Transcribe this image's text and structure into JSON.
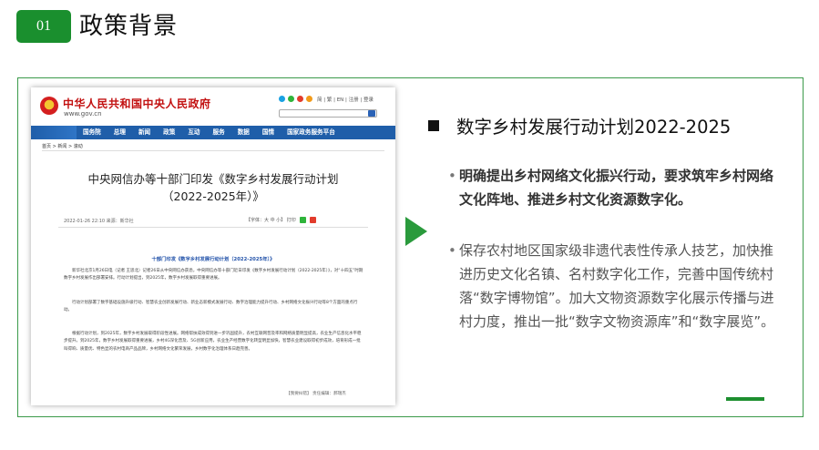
{
  "header": {
    "number": "01",
    "title": "政策背景"
  },
  "screenshot": {
    "site_name": "中华人民共和国中央人民政府",
    "site_url": "www.gov.cn",
    "top_links": "简 | 繁 | EN | 注册 | 登录",
    "nav": [
      "国务院",
      "总理",
      "新闻",
      "政策",
      "互动",
      "服务",
      "数据",
      "国情",
      "国家政务服务平台"
    ],
    "breadcrumb": "首页 > 新闻 > 滚动",
    "article_title_line1": "中央网信办等十部门印发《数字乡村发展行动计划",
    "article_title_line2": "（2022-2025年）》",
    "meta": "2022-01-26 22:10   来源：新华社",
    "meta_tools": "【字体：大 中 小】   打印",
    "sub_title": "十部门印发《数字乡村发展行动计划（2022-2025年）》",
    "para1": "新华社北京1月26日电（记者 王思北）记者26日从中央网信办获悉，中央网信办等十部门近日印发《数字乡村发展行动计划（2022-2025年）》，对“十四五”时期数字乡村发展作出部署安排。行动计划提出，到2025年，数字乡村发展取得重要进展。",
    "para2": "行动计划部署了数字基础设施升级行动、智慧农业创新发展行动、新业态新模式发展行动、数字治理能力提升行动、乡村网络文化振兴行动等8个方面的重点行动。",
    "para3": "根据行动计划，到2025年，数字乡村发展取得阶段性进展。网络帮扶成效得到进一步巩固提升，农村互联网普及率和网络质量明显提高，农业生产信息化水平稳步提升。到2025年，数字乡村发展取得重要进展，乡村4G深化普及、5G创新应用，农业生产经营数字化转型明显加快，智慧农业建设取得初步成效，培育形成一批叫得响、质量优、特色显的农村电商产品品牌，乡村网络文化繁荣发展，乡村数字化治理体系日趋完善。",
    "footer": "【我要纠错】    责任编辑：郝瑞杰"
  },
  "right": {
    "plan_title": "数字乡村发展行动计划2022-2025",
    "bullets": [
      "明确提出乡村网络文化振兴行动，要求筑牢乡村网络文化阵地、推进乡村文化资源数字化。",
      "保存农村地区国家级非遗代表性传承人技艺，加快推进历史文化名镇、名村数字化工作，完善中国传统村落“数字博物馆”。加大文物资源数字化展示传播与进村力度，推出一批“数字文物资源库”和“数字展览”。"
    ],
    "bullet_symbol": "•"
  },
  "colors": {
    "accent_green": "#1a8f2e",
    "gov_red": "#c21010",
    "gov_blue": "#1f5ea9"
  }
}
